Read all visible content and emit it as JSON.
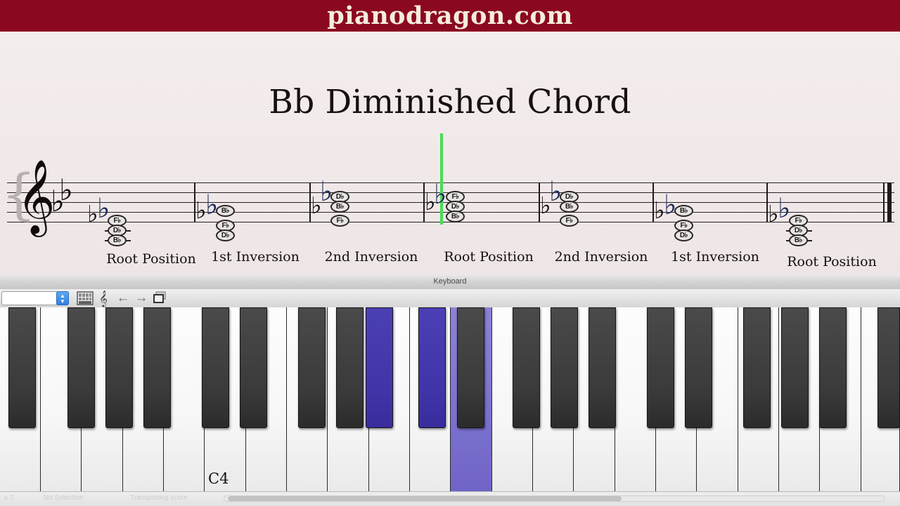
{
  "banner": {
    "site": "pianodragon.com"
  },
  "score": {
    "title": "Bb Diminished Chord",
    "clef_icon": "treble-clef-icon",
    "key_signature": [
      "flat",
      "flat"
    ],
    "playhead_color": "#46dd52",
    "chords": [
      {
        "label": "Root Position",
        "notes": [
          "F♭",
          "D♭",
          "B♭"
        ],
        "accidentals": [
          "flat",
          "flat"
        ]
      },
      {
        "label": "1st Inversion",
        "notes": [
          "B♭",
          "F♭",
          "D♭"
        ],
        "accidentals": [
          "flat",
          "flat"
        ]
      },
      {
        "label": "2nd Inversion",
        "notes": [
          "D♭",
          "B♭",
          "F♭"
        ],
        "accidentals": [
          "flat",
          "flat"
        ]
      },
      {
        "label": "Root Position",
        "notes": [
          "F♭",
          "D♭",
          "B♭"
        ],
        "accidentals": [
          "flat",
          "flat"
        ],
        "playhead": true
      },
      {
        "label": "2nd Inversion",
        "notes": [
          "D♭",
          "B♭",
          "F♭"
        ],
        "accidentals": [
          "flat",
          "flat"
        ]
      },
      {
        "label": "1st Inversion",
        "notes": [
          "B♭",
          "F♭",
          "D♭"
        ],
        "accidentals": [
          "flat",
          "flat"
        ]
      },
      {
        "label": "Root Position",
        "notes": [
          "F♭",
          "D♭",
          "B♭"
        ],
        "accidentals": [
          "flat",
          "flat"
        ]
      }
    ]
  },
  "keyboard_window": {
    "title": "Keyboard",
    "toolbar": {
      "instrument_value": "",
      "stepper_icon": "up-down-stepper-icon",
      "grid_icon": "keyboard-grid-icon",
      "clef_icon": "clef-icon",
      "prev_icon": "arrow-left-icon",
      "next_icon": "arrow-right-icon",
      "windows_icon": "stacked-windows-icon",
      "prev_label": "←",
      "next_label": "→"
    },
    "key_label": "C4",
    "highlight_color_black": "#4134a8",
    "highlight_color_white": "#7b71cf",
    "highlighted_keys": [
      "D♭4",
      "F♭4",
      "B♭4"
    ],
    "status": {
      "left": "s 7",
      "selection": "No Selection",
      "transpose": "Transposing score"
    }
  }
}
